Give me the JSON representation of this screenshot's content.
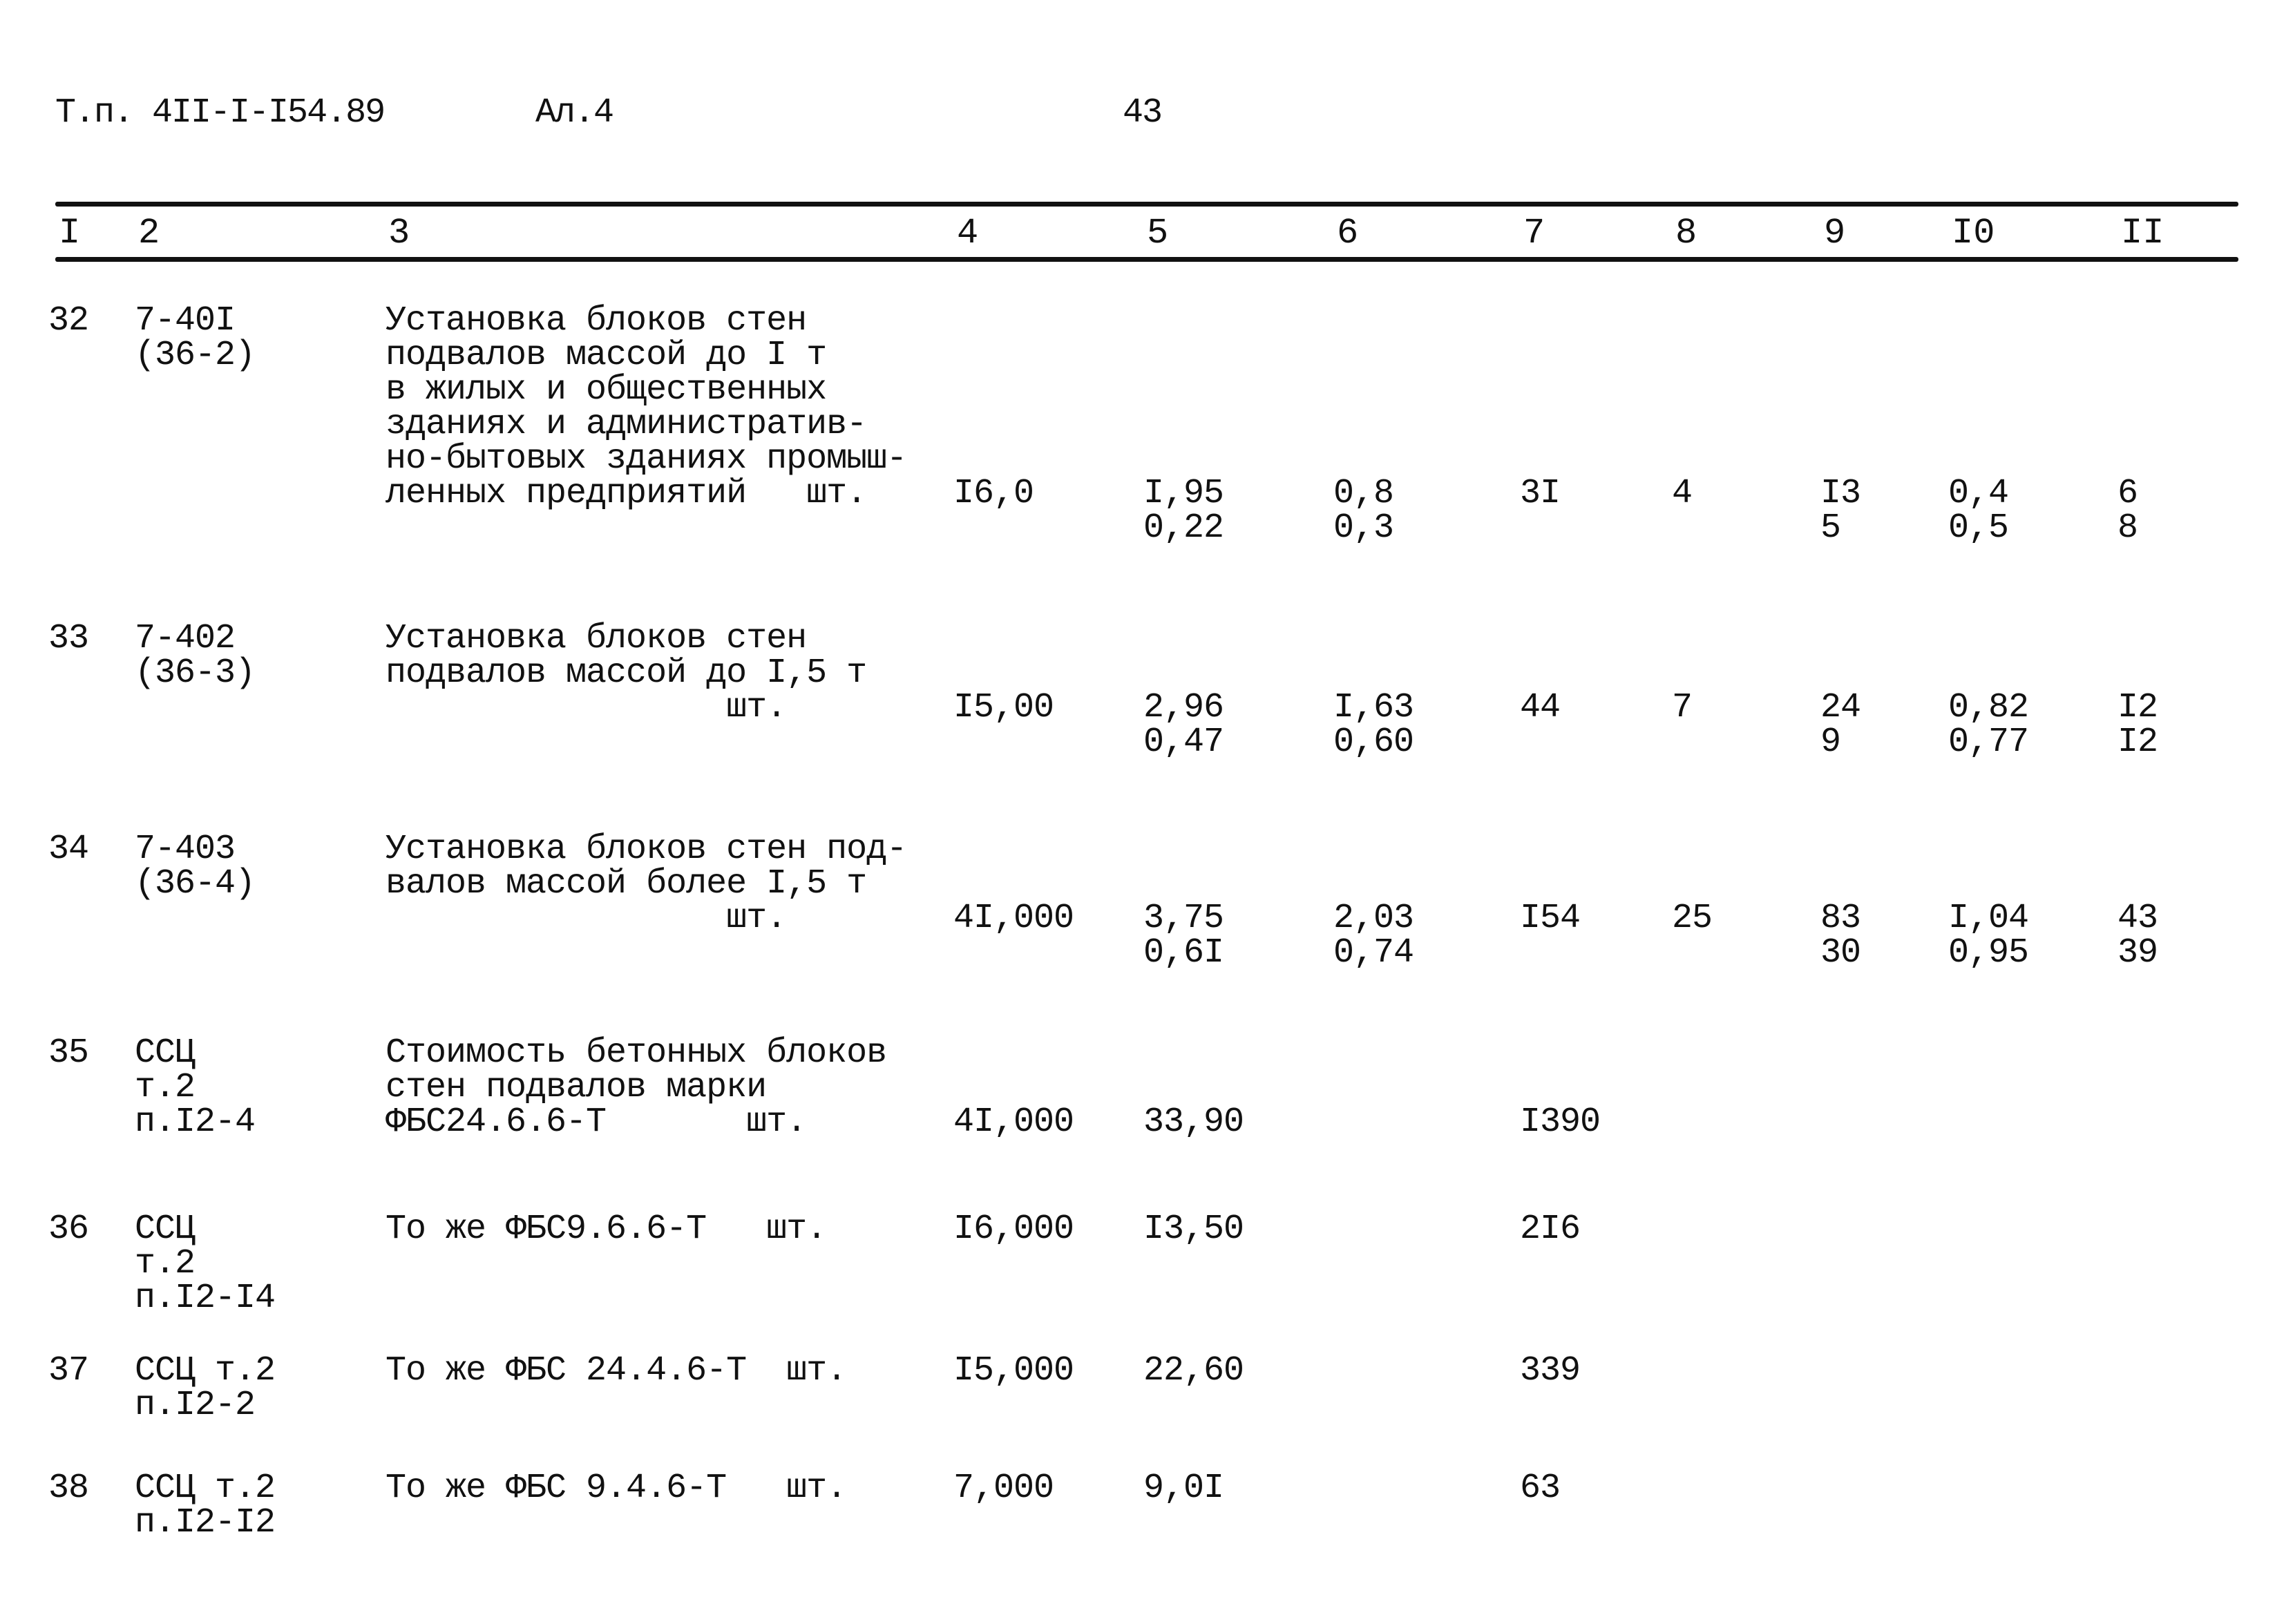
{
  "header": {
    "doc_code": "Т.п. 4II-I-I54.89",
    "album": "Ал.4",
    "page_number": "43"
  },
  "columns": [
    "I",
    "2",
    "3",
    "4",
    "5",
    "6",
    "7",
    "8",
    "9",
    "I0",
    "II"
  ],
  "rows": [
    {
      "num": "32",
      "code": [
        "7-40I",
        "(36-2)"
      ],
      "desc": [
        "Установка блоков стен",
        "подвалов массой до I т",
        "в жилых и общественных",
        "зданиях и административ-",
        "но-бытовых зданиях промыш-",
        "ленных предприятий   шт."
      ],
      "c4": "I6,0",
      "c5": [
        "I,95",
        "0,22"
      ],
      "c6": [
        "0,8",
        "0,3"
      ],
      "c7": "3I",
      "c8": "4",
      "c9": [
        "I3",
        "5"
      ],
      "c10": [
        "0,4",
        "0,5"
      ],
      "c11": [
        "6",
        "8"
      ]
    },
    {
      "num": "33",
      "code": [
        "7-402",
        "(36-3)"
      ],
      "desc": [
        "Установка блоков стен",
        "подвалов массой до I,5 т",
        "                 шт."
      ],
      "c4": "I5,00",
      "c5": [
        "2,96",
        "0,47"
      ],
      "c6": [
        "I,63",
        "0,60"
      ],
      "c7": "44",
      "c8": "7",
      "c9": [
        "24",
        "9"
      ],
      "c10": [
        "0,82",
        "0,77"
      ],
      "c11": [
        "I2",
        "I2"
      ]
    },
    {
      "num": "34",
      "code": [
        "7-403",
        "(36-4)"
      ],
      "desc": [
        "Установка блоков стен под-",
        "валов массой более I,5 т",
        "                 шт."
      ],
      "c4": "4I,000",
      "c5": [
        "3,75",
        "0,6I"
      ],
      "c6": [
        "2,03",
        "0,74"
      ],
      "c7": "I54",
      "c8": "25",
      "c9": [
        "83",
        "30"
      ],
      "c10": [
        "I,04",
        "0,95"
      ],
      "c11": [
        "43",
        "39"
      ]
    },
    {
      "num": "35",
      "code": [
        "ССЦ",
        "т.2",
        "п.I2-4"
      ],
      "desc": [
        "Стоимость бетонных блоков",
        "стен подвалов марки",
        "ФБС24.6.6-Т       шт."
      ],
      "c4": "4I,000",
      "c5": [
        "33,90"
      ],
      "c7": "I390"
    },
    {
      "num": "36",
      "code": [
        "ССЦ",
        "т.2",
        "п.I2-I4"
      ],
      "desc": [
        "То же ФБС9.6.6-Т   шт."
      ],
      "c4": "I6,000",
      "c5": [
        "I3,50"
      ],
      "c7": "2I6"
    },
    {
      "num": "37",
      "code": [
        "ССЦ т.2",
        "п.I2-2"
      ],
      "desc": [
        "То же ФБС 24.4.6-Т  шт."
      ],
      "c4": "I5,000",
      "c5": [
        "22,60"
      ],
      "c7": "339"
    },
    {
      "num": "38",
      "code": [
        "ССЦ т.2",
        "п.I2-I2"
      ],
      "desc": [
        "То же ФБС 9.4.6-Т   шт."
      ],
      "c4": "7,000",
      "c5": [
        "9,0I"
      ],
      "c7": "63"
    }
  ]
}
